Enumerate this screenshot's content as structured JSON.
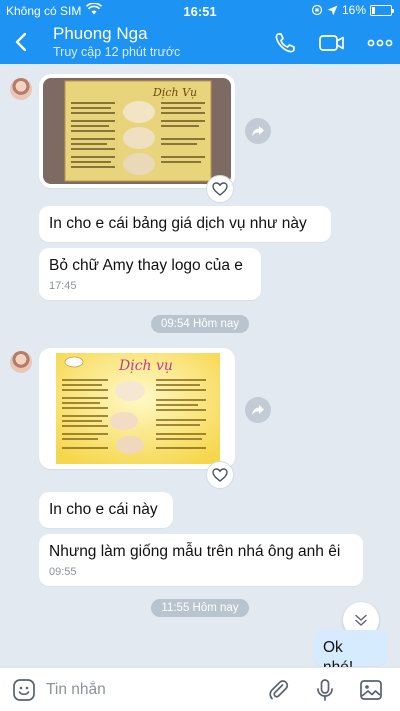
{
  "status": {
    "carrier": "Không có SIM",
    "time": "16:51",
    "battery": "16%",
    "battery_level": 0.16
  },
  "header": {
    "name": "Phuong Nga",
    "subtitle": "Truy cập 12 phút trước"
  },
  "messages": {
    "m1": {
      "text": "In cho e cái bảng giá dịch vụ như này"
    },
    "m2": {
      "text": "Bỏ chữ Amy thay logo của e",
      "time": "17:45"
    },
    "sep1": "09:54 Hôm nay",
    "m3": {
      "text": "In cho e cái này"
    },
    "m4": {
      "text": "Nhưng làm giống mẫu trên nhá ông anh êi",
      "time": "09:55"
    },
    "sep2": "11:55 Hôm nay",
    "m5": {
      "text": "Ok nhé!"
    }
  },
  "composer": {
    "placeholder": "Tin nhắn"
  },
  "colors": {
    "header": "#1d93f3",
    "background": "#e2e9f1",
    "my_bubble": "#d6ecfe"
  },
  "icons": [
    "back-icon",
    "phone-icon",
    "video-call-icon",
    "more-icon",
    "share-icon",
    "heart-icon",
    "scroll-down-icon",
    "emoji-icon",
    "attach-icon",
    "microphone-icon",
    "image-icon"
  ]
}
